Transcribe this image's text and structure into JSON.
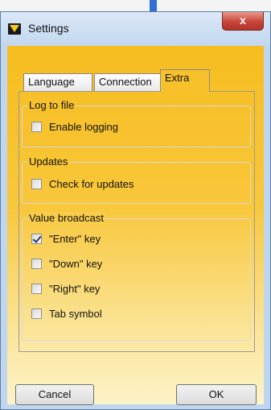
{
  "window": {
    "title": "Settings",
    "close_glyph": "x",
    "icon": "app-logo-icon"
  },
  "tabs": [
    {
      "label": "Language",
      "active": false
    },
    {
      "label": "Connection",
      "active": false
    },
    {
      "label": "Extra",
      "active": true
    }
  ],
  "groups": {
    "log": {
      "title": "Log to file",
      "options": [
        {
          "label": "Enable logging",
          "checked": false
        }
      ]
    },
    "updates": {
      "title": "Updates",
      "options": [
        {
          "label": "Check for updates",
          "checked": false
        }
      ]
    },
    "value_broadcast": {
      "title": "Value broadcast",
      "options": [
        {
          "label": "\"Enter\" key",
          "checked": true
        },
        {
          "label": "\"Down\" key",
          "checked": false
        },
        {
          "label": "\"Right\" key",
          "checked": false
        },
        {
          "label": "Tab symbol",
          "checked": false
        }
      ]
    }
  },
  "buttons": {
    "cancel": "Cancel",
    "ok": "OK"
  },
  "colors": {
    "accent": "#f6bd1f",
    "close": "#c9443a",
    "titlebar": "#c2d7ef"
  }
}
